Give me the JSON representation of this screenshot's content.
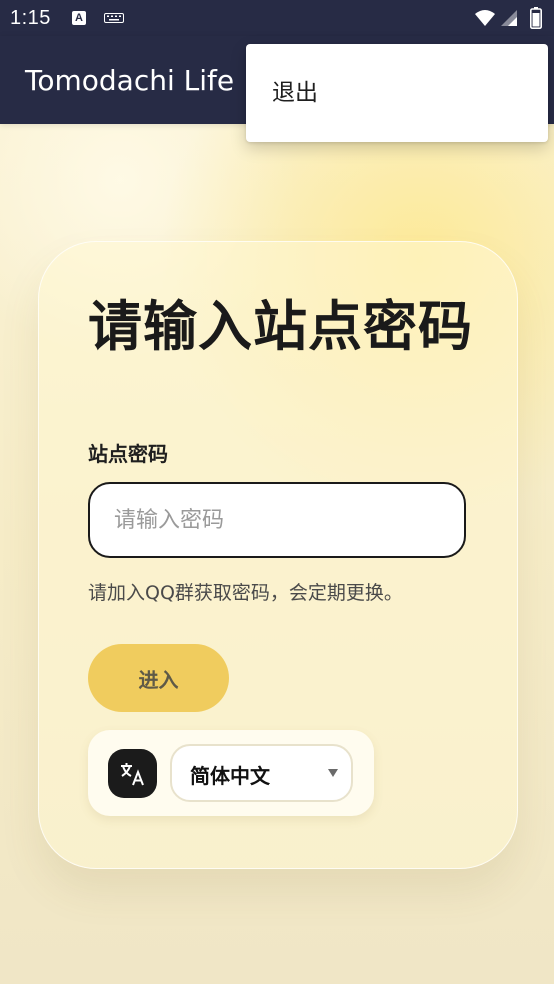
{
  "status_bar": {
    "time": "1:15",
    "a_icon_text": "A",
    "icons": [
      "a-icon",
      "keyboard-icon",
      "wifi-icon",
      "signal-icon",
      "battery-icon"
    ]
  },
  "app_bar": {
    "title": "Tomodachi Life",
    "background_color": "#272b45"
  },
  "menu": {
    "items": [
      {
        "label": "退出"
      }
    ]
  },
  "card": {
    "title": "请输入站点密码",
    "password_label": "站点密码",
    "password_placeholder": "请输入密码",
    "password_value": "",
    "hint": "请加入QQ群获取密码，会定期更换。",
    "enter_button": "进入",
    "enter_button_color": "#f0cc5e",
    "language": {
      "icon": "translate-icon",
      "selected": "简体中文"
    }
  }
}
